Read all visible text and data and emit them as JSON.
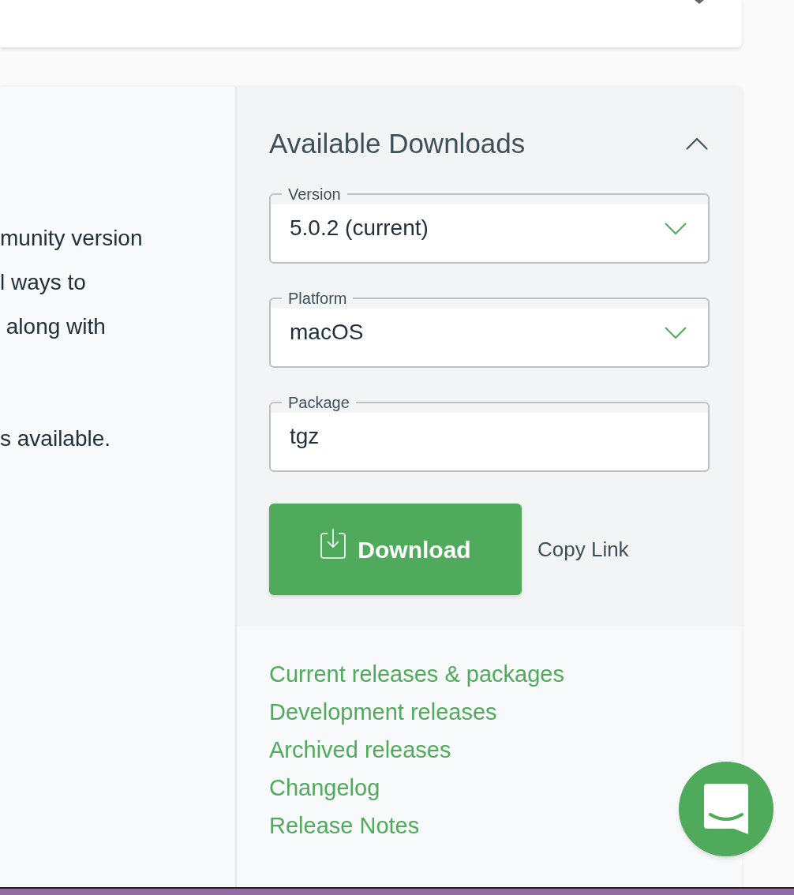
{
  "intro_lines": [
    "munity version",
    "l ways to",
    " along with",
    "s available."
  ],
  "downloads": {
    "title": "Available Downloads",
    "expanded": true,
    "fields": [
      {
        "label": "Version",
        "value": "5.0.2 (current)",
        "kind": "select"
      },
      {
        "label": "Platform",
        "value": "macOS",
        "kind": "select"
      },
      {
        "label": "Package",
        "value": "tgz",
        "kind": "text"
      }
    ],
    "download_button": "Download",
    "copy_link": "Copy Link",
    "links": [
      "Current releases & packages",
      "Development releases",
      "Archived releases",
      "Changelog",
      "Release Notes"
    ]
  }
}
